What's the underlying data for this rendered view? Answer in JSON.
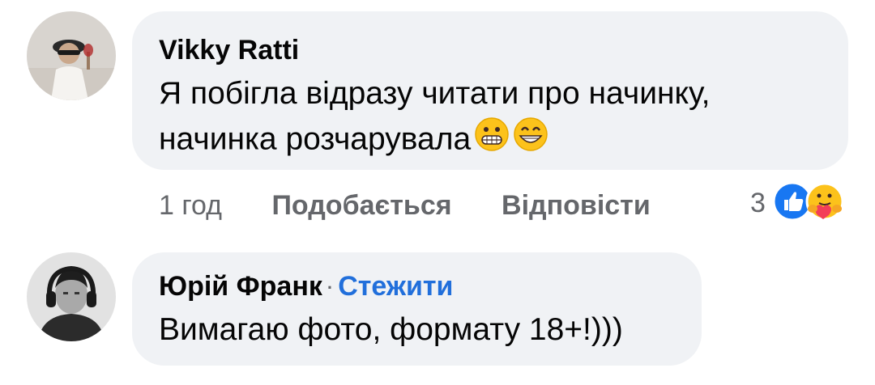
{
  "comments": [
    {
      "author": "Vikky Ratti",
      "text_lines": [
        "Я побігла відразу читати про начинку,",
        "начинка розчарувала"
      ],
      "emojis": [
        "grimacing-face-emoji",
        "beaming-face-emoji"
      ],
      "time": "1 год",
      "like_label": "Подобається",
      "reply_label": "Відповісти",
      "reaction_count": "3",
      "reaction_icons": [
        "like-reaction-icon",
        "care-reaction-icon"
      ]
    },
    {
      "author": "Юрій Франк",
      "separator": "·",
      "follow_label": "Стежити",
      "text_lines": [
        "Вимагаю фото, формату 18+!)))"
      ]
    }
  ],
  "colors": {
    "bubble": "#f0f2f5",
    "meta_text": "#65676b",
    "follow_link": "#216fdb",
    "like_blue": "#1877f2"
  }
}
